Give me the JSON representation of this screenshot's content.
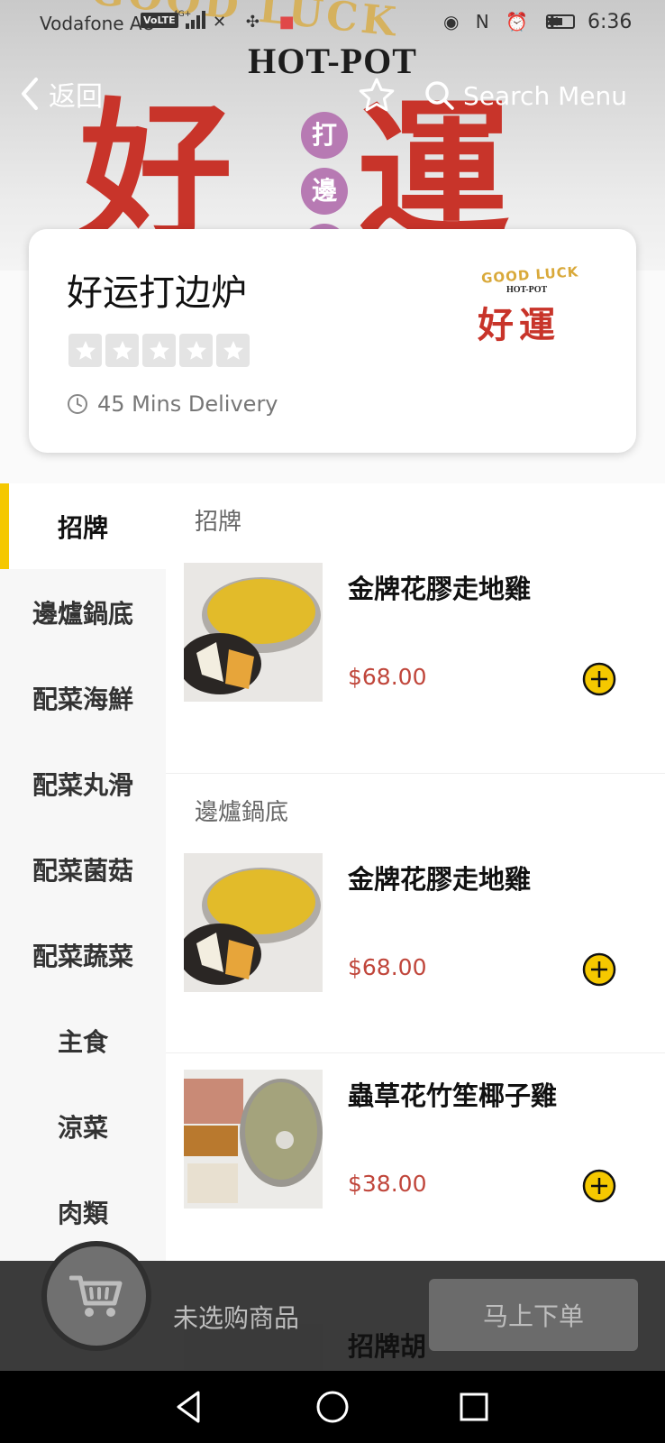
{
  "status_bar": {
    "carrier": "Vodafone AU",
    "volte": "VoLTE",
    "network": "4G+",
    "time": "6:36"
  },
  "hero": {
    "arc_text": "GOOD LUCK",
    "hotpot_text": "HOT-POT",
    "big_left": "好",
    "big_right": "運",
    "seal": [
      "打",
      "邊"
    ]
  },
  "nav": {
    "back_label": "返回",
    "search_label": "Search Menu"
  },
  "restaurant": {
    "name": "好运打边炉",
    "rating_stars": 5,
    "rating_value": 0,
    "delivery": "45 Mins Delivery",
    "logo": {
      "line1": "GOOD LUCK",
      "line2": "HOT-POT",
      "line3": "好運"
    }
  },
  "categories": [
    {
      "label": "招牌",
      "active": true
    },
    {
      "label": "邊爐鍋底",
      "active": false
    },
    {
      "label": "配菜海鮮",
      "active": false
    },
    {
      "label": "配菜丸滑",
      "active": false
    },
    {
      "label": "配菜菌菇",
      "active": false
    },
    {
      "label": "配菜蔬菜",
      "active": false
    },
    {
      "label": "主食",
      "active": false
    },
    {
      "label": "涼菜",
      "active": false
    },
    {
      "label": "肉類",
      "active": false
    }
  ],
  "menu": {
    "sections": [
      {
        "title": "招牌",
        "items": [
          {
            "name": "金牌花膠走地雞",
            "price": "$68.00"
          }
        ]
      },
      {
        "title": "邊爐鍋底",
        "items": [
          {
            "name": "金牌花膠走地雞",
            "price": "$68.00"
          },
          {
            "name": "蟲草花竹笙椰子雞",
            "price": "$38.00"
          },
          {
            "name": "招牌胡"
          }
        ]
      }
    ]
  },
  "cart": {
    "empty_text": "未选购商品",
    "order_button": "马上下单"
  },
  "colors": {
    "accent_yellow": "#f5c800",
    "price_red": "#c0463b",
    "brand_red": "#c8342a",
    "cart_bar": "#303030"
  }
}
